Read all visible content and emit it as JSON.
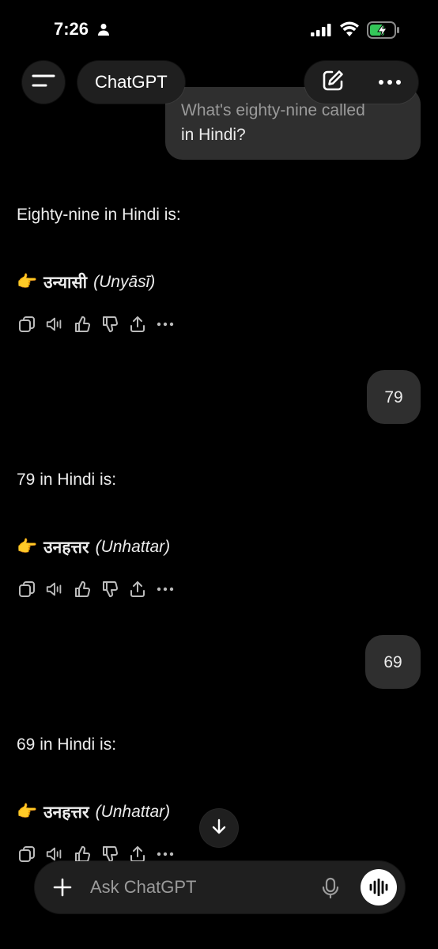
{
  "status_bar": {
    "time": "7:26"
  },
  "header": {
    "title": "ChatGPT"
  },
  "messages": [
    {
      "user_line1": "What's eighty-nine called",
      "user_line2": "in Hindi?"
    },
    {
      "reply": "Eighty-nine in Hindi is:",
      "pointer": "👉",
      "hindi": "उन्यासी",
      "roman": "(Unyāsī)"
    },
    {
      "user": "79"
    },
    {
      "reply": "79 in Hindi is:",
      "pointer": "👉",
      "hindi": "उनहत्तर",
      "roman": "(Unhattar)"
    },
    {
      "user": "69"
    },
    {
      "reply": "69 in Hindi is:",
      "pointer": "👉",
      "hindi": "उनहत्तर",
      "roman": "(Unhattar)"
    }
  ],
  "composer": {
    "placeholder": "Ask ChatGPT"
  },
  "icons": {
    "menu": "menu-icon",
    "new_chat": "edit-icon",
    "more": "more-icon",
    "copy": "copy-icon",
    "read_aloud": "speaker-icon",
    "like": "thumbs-up-icon",
    "dislike": "thumbs-down-icon",
    "share": "share-icon",
    "plus": "plus-icon",
    "mic": "mic-icon",
    "voice": "voice-mode-icon",
    "scroll_down": "arrow-down-icon"
  },
  "colors": {
    "background": "#000000",
    "bubble": "#2f2f2f",
    "battery": "#34c759"
  }
}
